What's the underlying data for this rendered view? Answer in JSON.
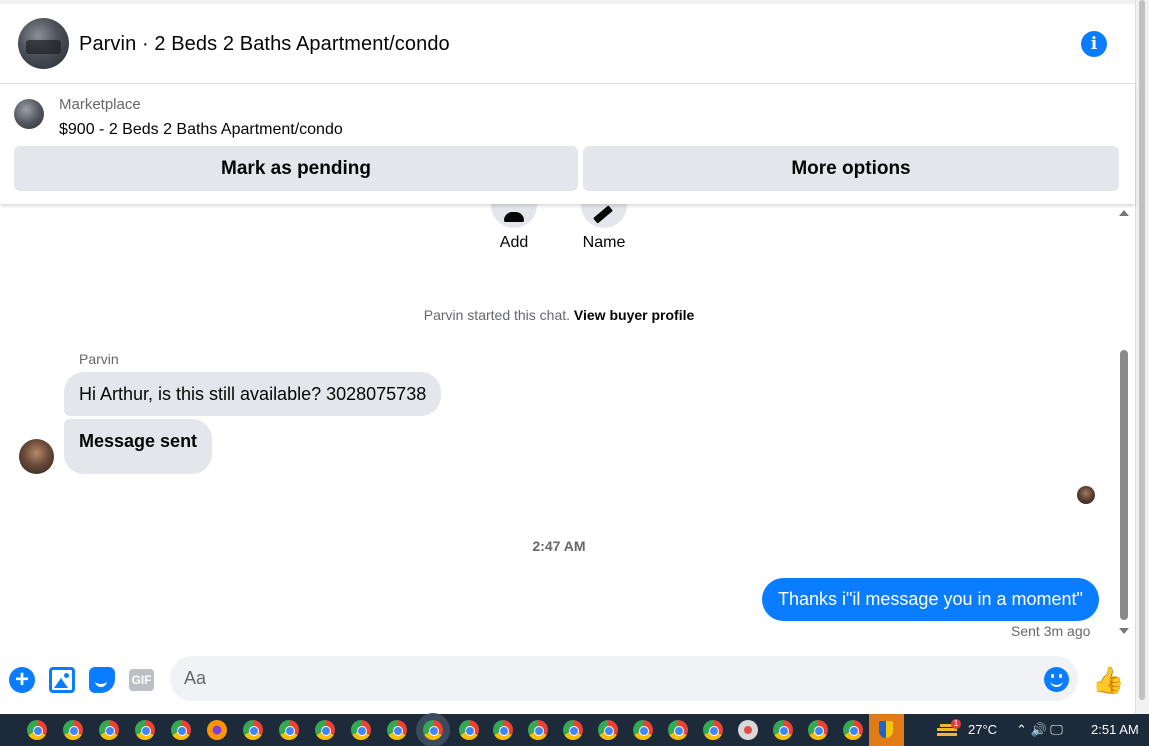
{
  "header": {
    "title": "Parvin · 2 Beds 2 Baths Apartment/condo",
    "info_icon": "i"
  },
  "marketplace": {
    "label": "Marketplace",
    "listing": "$900 - 2 Beds 2 Baths Apartment/condo",
    "mark_pending_label": "Mark as pending",
    "more_options_label": "More options"
  },
  "actions": {
    "add_label": "Add",
    "name_label": "Name"
  },
  "chat": {
    "started_text": "Parvin started this chat.",
    "view_buyer_profile": "View buyer profile",
    "sender_name": "Parvin",
    "incoming_message": "Hi Arthur, is this still available? 3028075738",
    "incoming_status": "Message sent",
    "timestamp": "2:47 AM",
    "outgoing_message": "Thanks i\"il message you in a moment\"",
    "sent_status": "Sent 3m ago"
  },
  "composer": {
    "placeholder": "Aa",
    "plus_glyph": "+",
    "gif_label": "GIF",
    "like_glyph": "👍"
  },
  "taskbar": {
    "weather_badge": "1",
    "temperature": "27°C",
    "tray_icons": "⌃ 🔊 🖵",
    "clock": "2:51 AM"
  },
  "colors": {
    "accent": "#0a7cff",
    "bubble_incoming": "#e4e6eb",
    "taskbar": "#1c2a3a"
  }
}
